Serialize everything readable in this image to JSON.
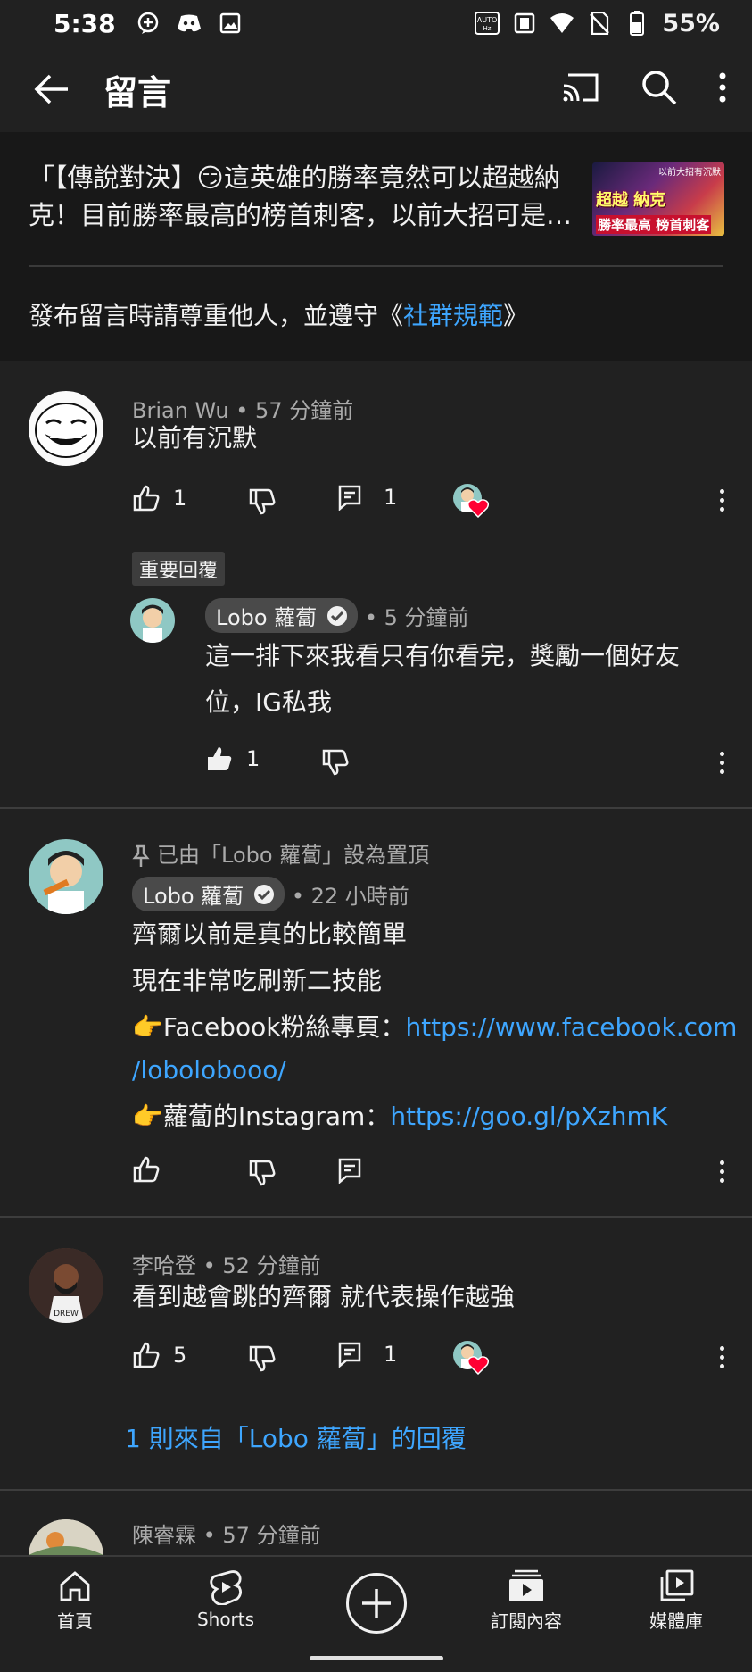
{
  "status_bar": {
    "time": "5:38",
    "battery": "55%"
  },
  "app_bar": {
    "title": "留言"
  },
  "header": {
    "video_title": "「【傳說對決】😏這英雄的勝率竟然可以超越納克！目前勝率最高的榜首刺客，以前大招可是…",
    "thumbnail": {
      "corner_text": "以前大招有沉默",
      "main_text": "超越 納克",
      "bottom_text": "勝率最高 榜首刺客"
    },
    "guideline_prefix": "發布留言時請尊重他人，並遵守《",
    "guideline_link": "社群規範",
    "guideline_suffix": "》"
  },
  "comments": [
    {
      "author": "Brian Wu",
      "time": " • 57 分鐘前",
      "text": "以前有沉默",
      "likes": "1",
      "replies": "1"
    },
    {
      "badge": "重要回覆",
      "author": "Lobo 蘿蔔",
      "time": " • 5 分鐘前",
      "text_line1": "這一排下來我看只有你看完，獎勵一個好友",
      "text_line2": "位，IG私我",
      "likes": "1"
    },
    {
      "pinned": "已由「Lobo 蘿蔔」設為置頂",
      "author": "Lobo 蘿蔔",
      "time": " • 22 小時前",
      "line1": "齊爾以前是真的比較簡單",
      "line2": "現在非常吃刷新二技能",
      "line3_prefix": "👉Facebook粉絲專頁：",
      "line3_link": "https://www.facebook.com",
      "line4_link": "/lobolobooo/",
      "line5_prefix": "👉蘿蔔的Instagram：",
      "line5_link": "https://goo.gl/pXzhmK"
    },
    {
      "author": "李哈登",
      "time": " • 52 分鐘前",
      "text": "看到越會跳的齊爾 就代表操作越強",
      "likes": "5",
      "replies": "1",
      "view_replies": "1 則來自「Lobo 蘿蔔」的回覆",
      "avatar_text": "DREW"
    },
    {
      "author": "陳睿霖",
      "time": " • 57 分鐘前"
    }
  ],
  "bottom_nav": {
    "home": "首頁",
    "shorts": "Shorts",
    "subscriptions": "訂閱內容",
    "library": "媒體庫"
  },
  "colors": {
    "background": "#212121",
    "header": "#181818",
    "link": "#3ea6ff",
    "meta": "#aaaaaa"
  }
}
